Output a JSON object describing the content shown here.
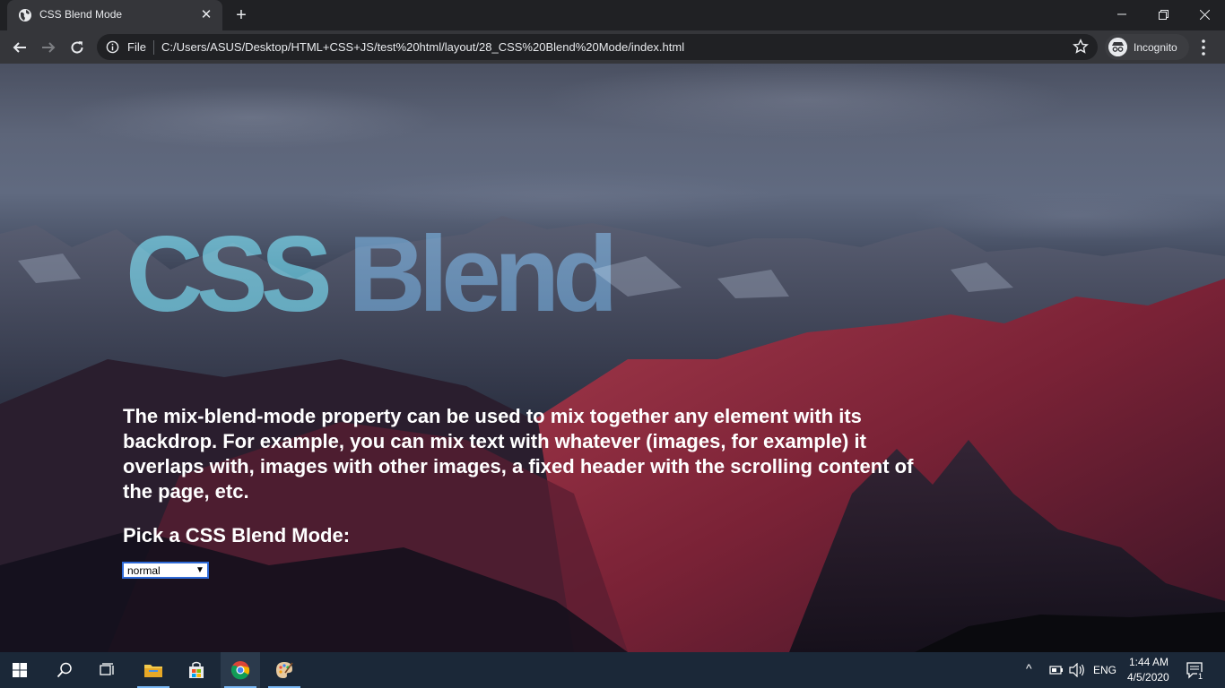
{
  "browser": {
    "tab_title": "CSS Blend Mode",
    "scheme_label": "File",
    "url": "C:/Users/ASUS/Desktop/HTML+CSS+JS/test%20html/layout/28_CSS%20Blend%20Mode/index.html",
    "profile_label": "Incognito"
  },
  "page": {
    "hero_word1": "CSS",
    "hero_word2": "Blend",
    "description": "The mix-blend-mode property can be used to mix together any element with its backdrop. For example, you can mix text with whatever (images, for example) it overlaps with, images with other images, a fixed header with the scrolling content of the page, etc.",
    "pick_heading": "Pick a CSS Blend Mode:",
    "blend_select_value": "normal",
    "colors": {
      "hero_cyan": "#3aaec8",
      "hero_blue": "#3f86c2",
      "mountain_red": "#8e2b3e",
      "sky": "#5d6579"
    }
  },
  "taskbar": {
    "apps": [
      "start-icon",
      "search-icon",
      "task-view-icon",
      "file-explorer-icon",
      "store-icon",
      "chrome-icon",
      "paint-icon"
    ],
    "language": "ENG",
    "time": "1:44 AM",
    "date": "4/5/2020",
    "notification_count": "1"
  }
}
